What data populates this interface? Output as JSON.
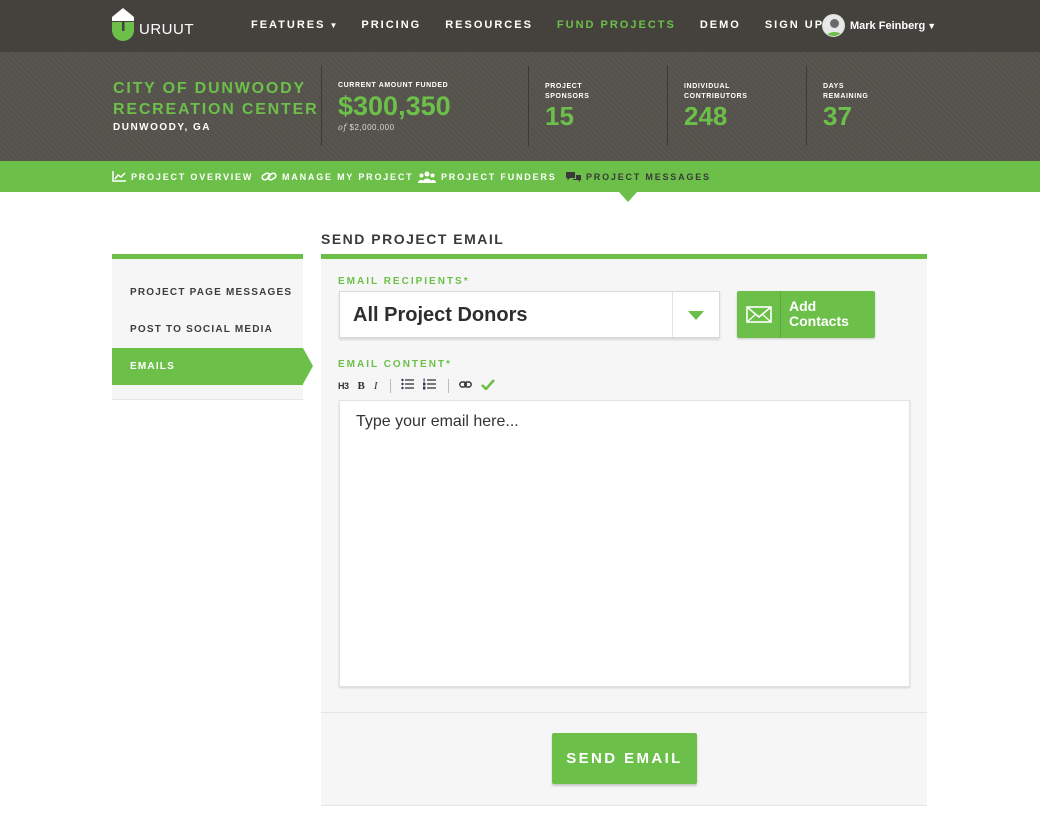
{
  "brand": {
    "name": "URUUT",
    "accent": "#6cc04a",
    "dark_bg": "#45423d"
  },
  "nav": {
    "items": [
      {
        "label": "FEATURES",
        "has_caret": true
      },
      {
        "label": "PRICING"
      },
      {
        "label": "RESOURCES"
      },
      {
        "label": "FUND PROJECTS",
        "active": true
      },
      {
        "label": "DEMO"
      },
      {
        "label": "SIGN UP"
      }
    ],
    "user": {
      "name": "Mark Feinberg"
    }
  },
  "project": {
    "title_line1": "CITY OF DUNWOODY",
    "title_line2": "RECREATION CENTER",
    "location": "DUNWOODY, GA",
    "stats": {
      "funded": {
        "label": "CURRENT AMOUNT FUNDED",
        "value": "$300,350",
        "goal_prefix": "of",
        "goal": "$2,000,000"
      },
      "sponsors": {
        "label_line1": "PROJECT",
        "label_line2": "SPONSORS",
        "value": "15"
      },
      "contributors": {
        "label_line1": "INDIVIDUAL",
        "label_line2": "CONTRIBUTORS",
        "value": "248"
      },
      "days": {
        "label_line1": "DAYS",
        "label_line2": "REMAINING",
        "value": "37"
      }
    }
  },
  "subnav": {
    "items": [
      {
        "label": "PROJECT OVERVIEW",
        "icon": "chart-line-icon"
      },
      {
        "label": "MANAGE MY PROJECT",
        "icon": "link-icon"
      },
      {
        "label": "PROJECT FUNDERS",
        "icon": "people-icon"
      },
      {
        "label": "PROJECT MESSAGES",
        "icon": "chat-bubbles-icon",
        "active": true
      }
    ]
  },
  "sidebar": {
    "items": [
      {
        "label": "PROJECT PAGE MESSAGES"
      },
      {
        "label": "POST TO SOCIAL MEDIA"
      },
      {
        "label": "EMAILS",
        "active": true
      }
    ]
  },
  "main": {
    "title": "SEND PROJECT EMAIL",
    "recipients_label": "EMAIL RECIPIENTS*",
    "recipients_value": "All Project Donors",
    "add_contacts_label": "Add Contacts",
    "content_label": "EMAIL CONTENT*",
    "toolbar": {
      "heading": "H3",
      "bold": "B",
      "italic": "I"
    },
    "editor_placeholder": "Type your email here...",
    "send_label": "SEND EMAIL"
  }
}
